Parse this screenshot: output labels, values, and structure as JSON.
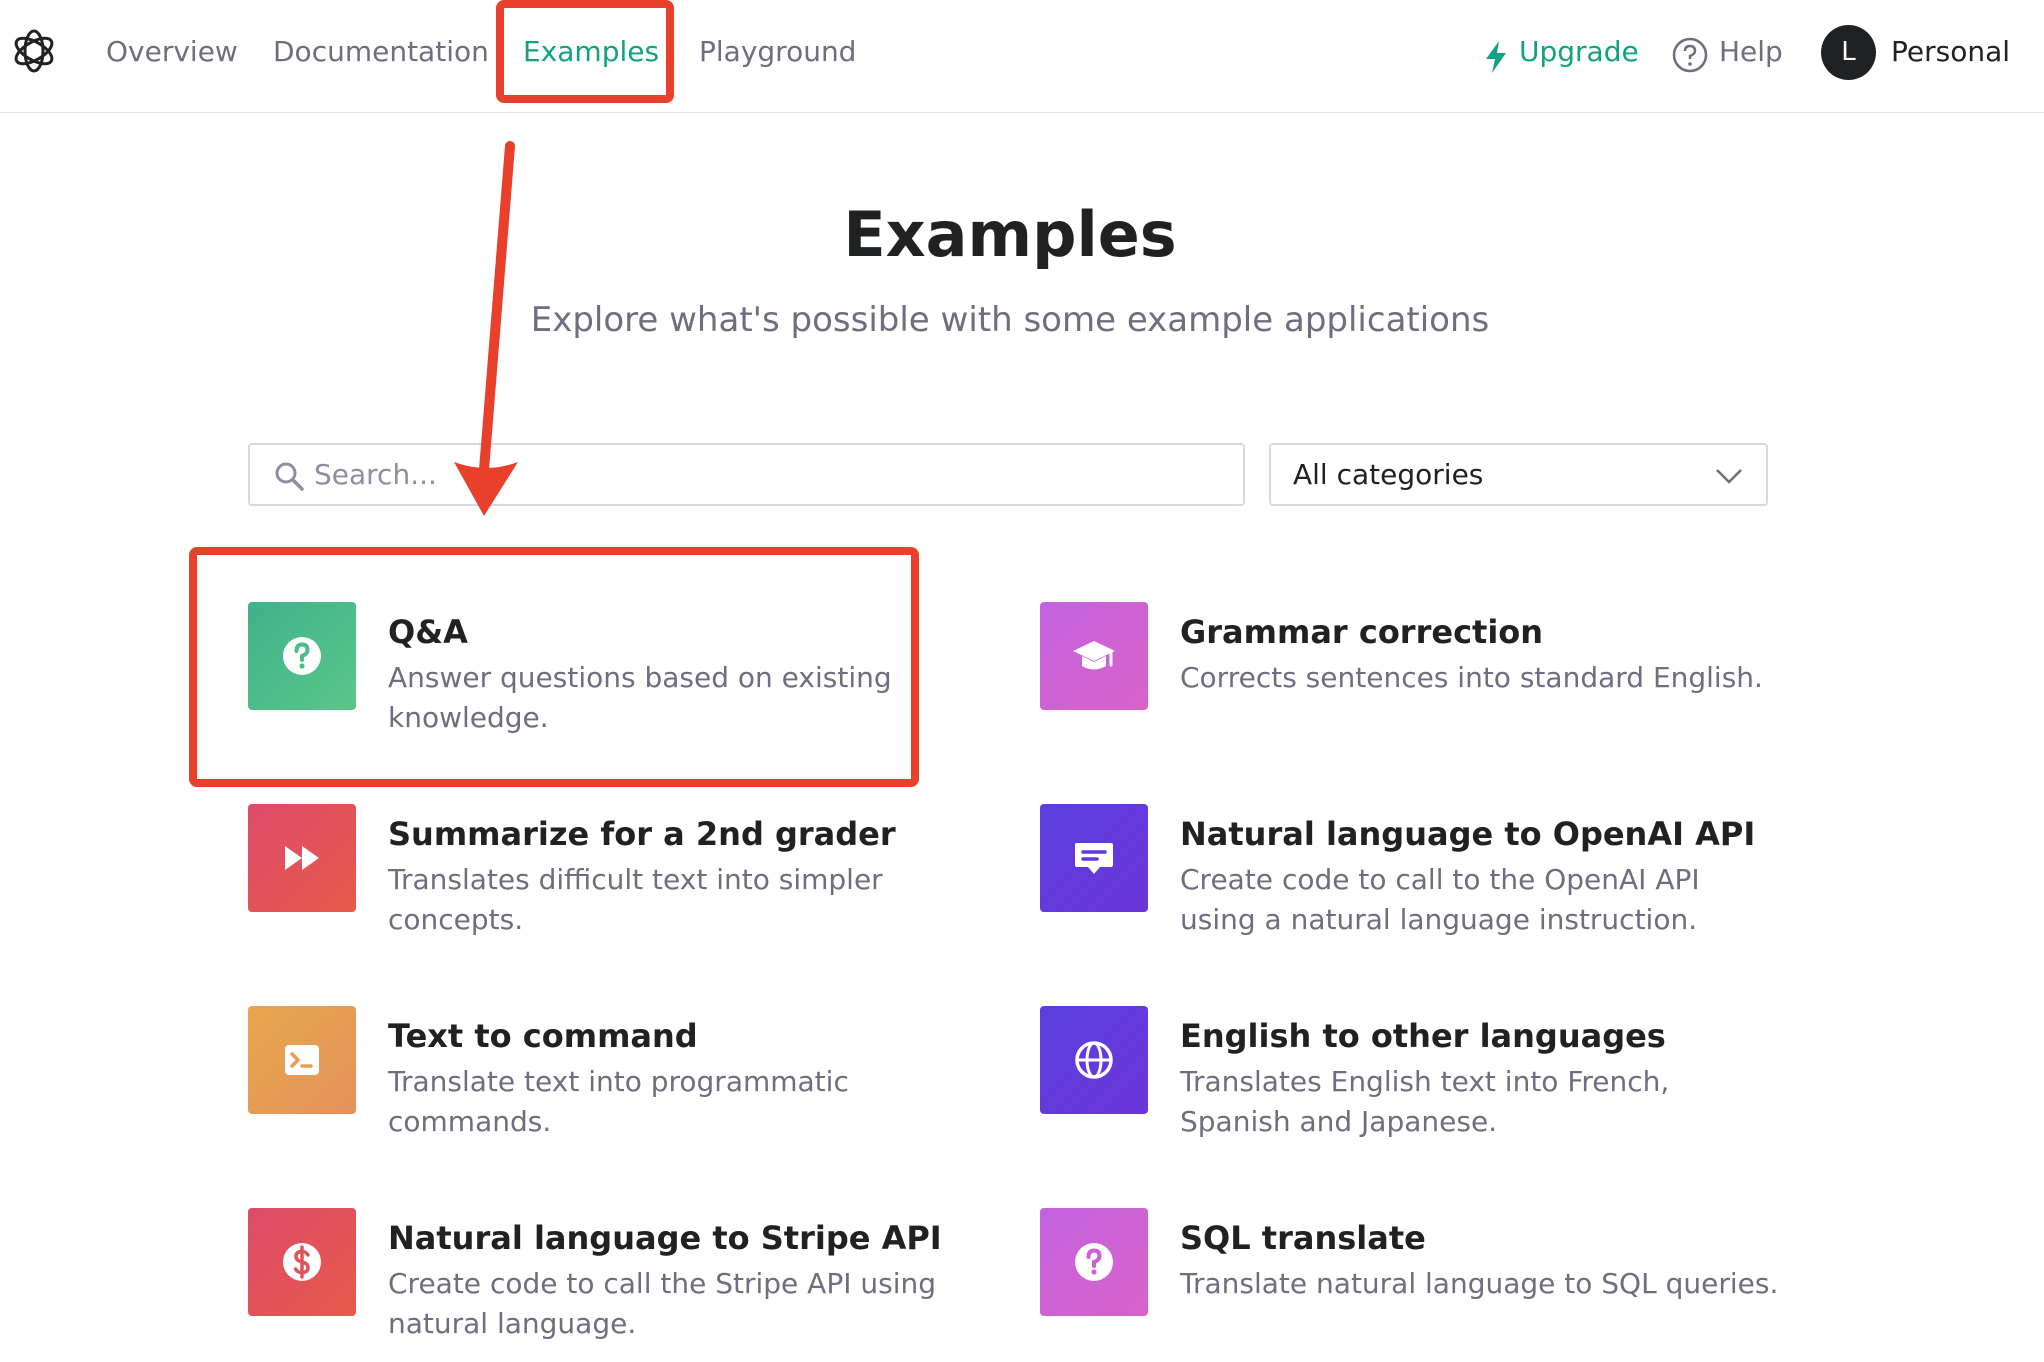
{
  "nav": {
    "links": [
      "Overview",
      "Documentation",
      "Examples",
      "Playground"
    ],
    "active": "Examples",
    "upgrade": "Upgrade",
    "help": "Help",
    "avatar_initial": "L",
    "account": "Personal"
  },
  "hero": {
    "title": "Examples",
    "subtitle": "Explore what's possible with some example applications"
  },
  "filters": {
    "search_placeholder": "Search...",
    "category": "All categories"
  },
  "examples": [
    {
      "title": "Q&A",
      "desc": "Answer questions based on existing knowledge.",
      "icon": "question-icon",
      "color": "#4cbc8a"
    },
    {
      "title": "Grammar correction",
      "desc": "Corrects sentences into standard English.",
      "icon": "graduation-cap-icon",
      "color": "#cc62d8"
    },
    {
      "title": "Summarize for a 2nd grader",
      "desc": "Translates difficult text into simpler concepts.",
      "icon": "fast-forward-icon",
      "color": "#e3525a"
    },
    {
      "title": "Natural language to OpenAI API",
      "desc": "Create code to call to the OpenAI API using a natural language instruction.",
      "icon": "chat-bubble-icon",
      "color": "#6239dc"
    },
    {
      "title": "Text to command",
      "desc": "Translate text into programmatic commands.",
      "icon": "terminal-icon",
      "color": "#e69e54"
    },
    {
      "title": "English to other languages",
      "desc": "Translates English text into French, Spanish and Japanese.",
      "icon": "globe-icon",
      "color": "#6239dc"
    },
    {
      "title": "Natural language to Stripe API",
      "desc": "Create code to call the Stripe API using natural language.",
      "icon": "dollar-icon",
      "color": "#e3525a"
    },
    {
      "title": "SQL translate",
      "desc": "Translate natural language to SQL queries.",
      "icon": "question-icon",
      "color": "#cc62d8"
    }
  ],
  "annotation_color": "#e8402a"
}
